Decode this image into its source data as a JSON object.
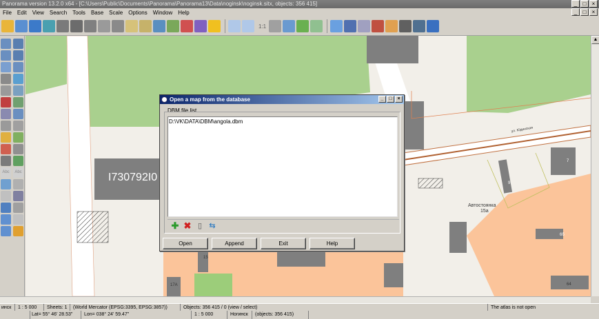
{
  "window": {
    "title": "Panorama version 13.2.0 x64 - [C:\\Users\\Public\\Documents\\Panorama\\Panorama13\\Data\\noginsk\\noginsk.sitx, objects: 356 415]"
  },
  "menu": [
    "File",
    "Edit",
    "View",
    "Search",
    "Tools",
    "Base",
    "Scale",
    "Options",
    "Window",
    "Help"
  ],
  "toolbar": {
    "scale_label": "1:1"
  },
  "map": {
    "labels": {
      "big_number": "I730792I0",
      "parking": "Автостоянка",
      "parking_no": "15а",
      "b7": "7",
      "b9": "9",
      "b15": "15",
      "b6b": "6б",
      "b64": "64",
      "b17a": "17А",
      "street": "ул. Юдинская"
    },
    "colors": {
      "background": "#f2efe9",
      "park": "#a8d08d",
      "residential": "#fbc49a",
      "building": "#7f7f7f",
      "road": "#ffffff"
    }
  },
  "dialog": {
    "title": "Open a map from the database",
    "group_label": "DBM file list",
    "files": [
      "D:\\VK\\DATA\\DBM\\angola.dbm"
    ],
    "buttons": {
      "open": "Open",
      "append": "Append",
      "exit": "Exit",
      "help": "Help"
    }
  },
  "status": {
    "scale_name": "инск",
    "scale": "1 : 5 000",
    "sheets": "Sheets: 1",
    "projection": "(World Mercator (EPSG:3395, EPSG:3857))",
    "objects": "Objects: 356 415 / 0 (view / select)",
    "atlas": "The atlas is not open",
    "lat": "Lat= 55° 46' 28.53\"",
    "lon": "Lon= 038° 24' 59.47\"",
    "scale2": "1 : 5 000",
    "map_name": "Ногинск",
    "map_objects": "(objects: 356 415)"
  }
}
